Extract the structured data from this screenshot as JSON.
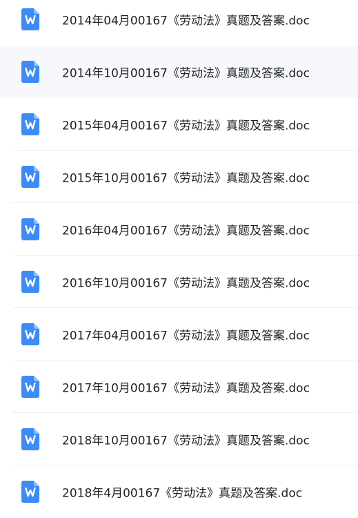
{
  "files": [
    {
      "name": "2014年04月00167《劳动法》真题及答案.doc",
      "icon": "word-doc-icon"
    },
    {
      "name": "2014年10月00167《劳动法》真题及答案.doc",
      "icon": "word-doc-icon"
    },
    {
      "name": "2015年04月00167《劳动法》真题及答案.doc",
      "icon": "word-doc-icon"
    },
    {
      "name": "2015年10月00167《劳动法》真题及答案.doc",
      "icon": "word-doc-icon"
    },
    {
      "name": "2016年04月00167《劳动法》真题及答案.doc",
      "icon": "word-doc-icon"
    },
    {
      "name": "2016年10月00167《劳动法》真题及答案.doc",
      "icon": "word-doc-icon"
    },
    {
      "name": "2017年04月00167《劳动法》真题及答案.doc",
      "icon": "word-doc-icon"
    },
    {
      "name": "2017年10月00167《劳动法》真题及答案.doc",
      "icon": "word-doc-icon"
    },
    {
      "name": "2018年10月00167《劳动法》真题及答案.doc",
      "icon": "word-doc-icon"
    },
    {
      "name": "2018年4月00167《劳动法》真题及答案.doc",
      "icon": "word-doc-icon"
    }
  ],
  "hovered_index": 1,
  "colors": {
    "icon_blue": "#3b8cf8",
    "icon_fold": "#8ec0ff",
    "hover_bg": "#f6f8fb",
    "text": "#1f2329"
  }
}
